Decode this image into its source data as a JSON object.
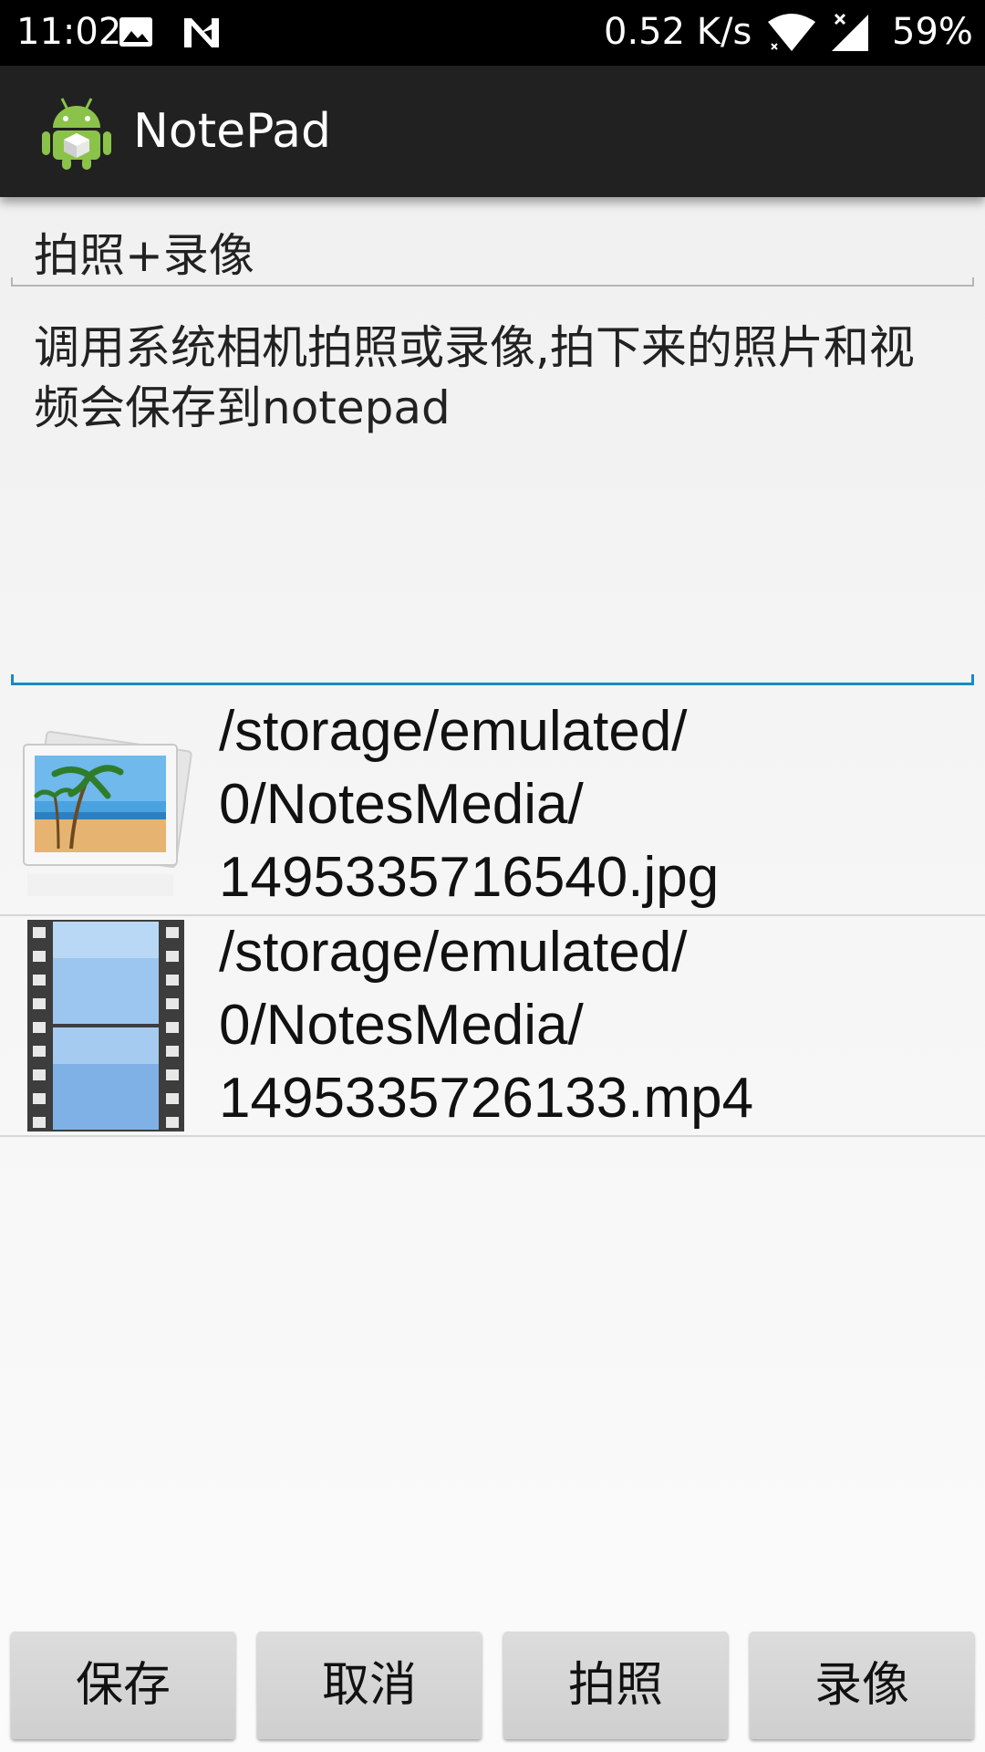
{
  "status_bar": {
    "time": "11:02",
    "net_speed": "0.52 K/s",
    "battery": "59%",
    "icons": [
      "image-notification-icon",
      "n-icon",
      "wifi-icon",
      "signal-icon"
    ]
  },
  "app_bar": {
    "title": "NotePad",
    "icon": "android-app-icon",
    "background": "#212121"
  },
  "note": {
    "title": "拍照+录像",
    "body": "调用系统相机拍照或录像,拍下来的照片和视频会保存到notepad",
    "accent": "#1a8ac4"
  },
  "media": [
    {
      "type": "image",
      "icon": "photo-thumbnail-icon",
      "path": "/storage/emulated/0/NotesMedia/1495335716540.jpg"
    },
    {
      "type": "video",
      "icon": "film-strip-icon",
      "path": "/storage/emulated/0/NotesMedia/1495335726133.mp4"
    }
  ],
  "buttons": {
    "save": "保存",
    "cancel": "取消",
    "photo": "拍照",
    "video": "录像"
  }
}
